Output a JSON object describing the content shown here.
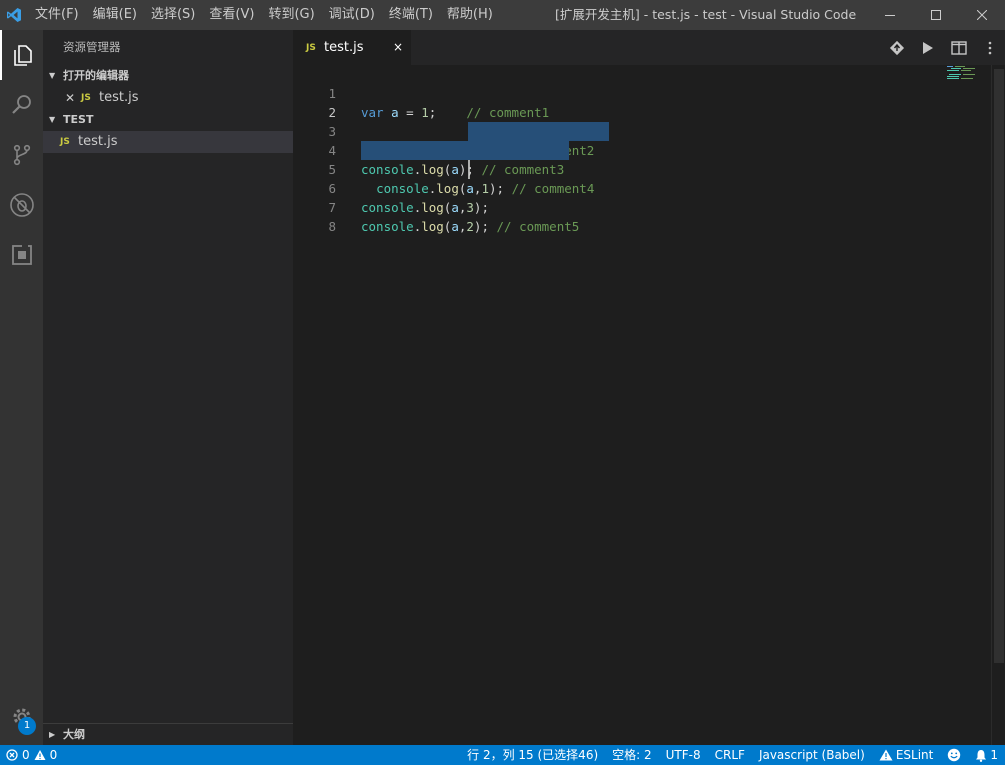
{
  "titlebar": {
    "menu": [
      "文件(F)",
      "编辑(E)",
      "选择(S)",
      "查看(V)",
      "转到(G)",
      "调试(D)",
      "终端(T)",
      "帮助(H)"
    ],
    "title": "[扩展开发主机] - test.js - test - Visual Studio Code"
  },
  "activitybar": {
    "items": [
      "files-icon",
      "search-icon",
      "source-control-icon",
      "debug-icon",
      "extensions-icon"
    ],
    "settings_badge": "1"
  },
  "sidebar": {
    "title": "资源管理器",
    "open_editors": {
      "header": "打开的编辑器",
      "items": [
        {
          "badge": "JS",
          "label": "test.js"
        }
      ]
    },
    "folder": {
      "header": "TEST",
      "items": [
        {
          "badge": "JS",
          "label": "test.js"
        }
      ]
    },
    "outline": {
      "header": "大纲"
    }
  },
  "editor": {
    "tab": {
      "badge": "JS",
      "label": "test.js",
      "close": "×"
    },
    "line_numbers": [
      "1",
      "2",
      "3",
      "4",
      "5",
      "6",
      "7",
      "8"
    ]
  },
  "statusbar": {
    "errors": "0",
    "warnings": "0",
    "position": "行 2，列 15 (已选择46)",
    "indent": "空格: 2",
    "encoding": "UTF-8",
    "eol": "CRLF",
    "language": "Javascript (Babel)",
    "eslint": "ESLint",
    "notifications": "1"
  },
  "colors": {
    "accent": "#007acc",
    "selection": "#264f78",
    "js_icon": "#cbcb41"
  }
}
